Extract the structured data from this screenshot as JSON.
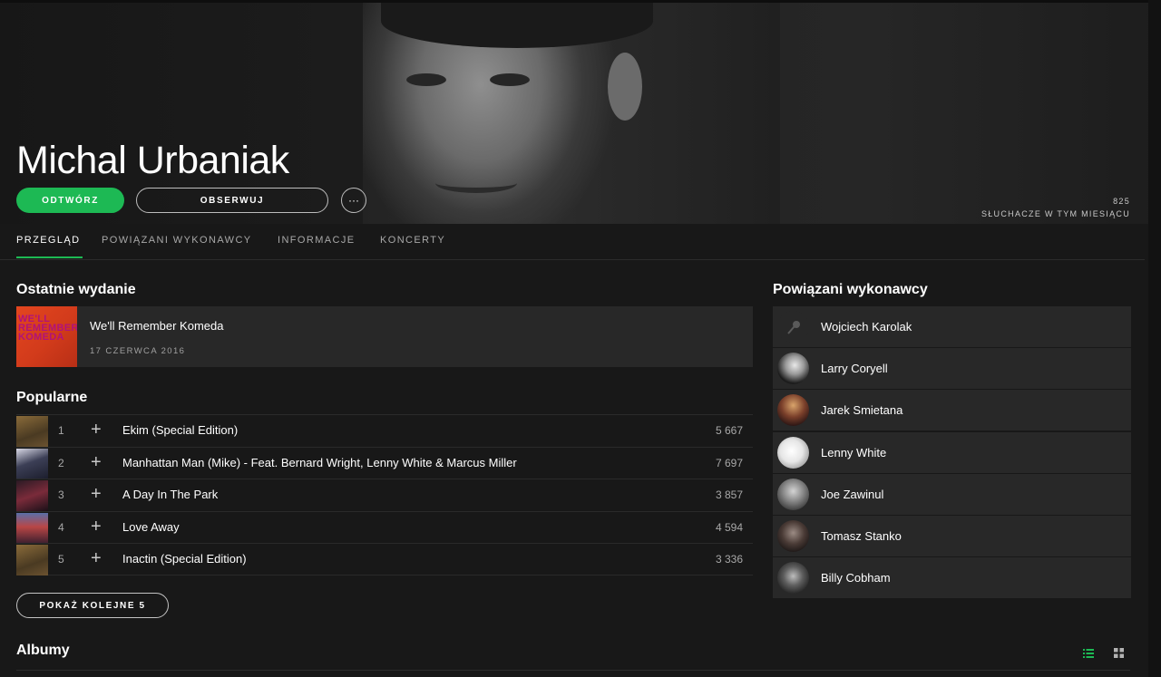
{
  "artist": {
    "name": "Michal Urbaniak",
    "play_label": "ODTWÓRZ",
    "follow_label": "OBSERWUJ",
    "more_label": "···",
    "listeners_count": "825",
    "listeners_label": "SŁUCHACZE W TYM MIESIĄCU"
  },
  "tabs": [
    {
      "label": "PRZEGLĄD",
      "active": true
    },
    {
      "label": "POWIĄZANI WYKONAWCY",
      "active": false
    },
    {
      "label": "INFORMACJE",
      "active": false
    },
    {
      "label": "KONCERTY",
      "active": false
    }
  ],
  "latest": {
    "heading": "Ostatnie wydanie",
    "title": "We'll Remember Komeda",
    "date": "17 CZERWCA 2016",
    "cover_text": [
      "WE'LL",
      "REMEMBER",
      "KOMEDA"
    ]
  },
  "popular": {
    "heading": "Popularne",
    "tracks": [
      {
        "num": "1",
        "title": "Ekim (Special Edition)",
        "plays": "5 667"
      },
      {
        "num": "2",
        "title": "Manhattan Man (Mike) - Feat. Bernard Wright, Lenny White & Marcus Miller",
        "plays": "7 697"
      },
      {
        "num": "3",
        "title": "A Day In The Park",
        "plays": "3 857"
      },
      {
        "num": "4",
        "title": "Love Away",
        "plays": "4 594"
      },
      {
        "num": "5",
        "title": "Inactin (Special Edition)",
        "plays": "3 336"
      }
    ],
    "add_icon": "+",
    "show_more_label": "POKAŻ KOLEJNE 5"
  },
  "albums": {
    "heading": "Albumy"
  },
  "related": {
    "heading": "Powiązani wykonawcy",
    "artists": [
      {
        "name": "Wojciech Karolak"
      },
      {
        "name": "Larry Coryell"
      },
      {
        "name": "Jarek Smietana"
      },
      {
        "name": "Lenny White"
      },
      {
        "name": "Joe Zawinul"
      },
      {
        "name": "Tomasz Stanko"
      },
      {
        "name": "Billy Cobham"
      }
    ]
  },
  "colors": {
    "accent": "#1db954",
    "background": "#181818",
    "card": "#282828"
  }
}
